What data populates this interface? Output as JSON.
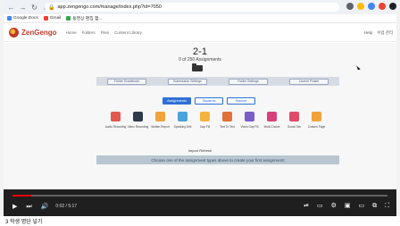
{
  "browser": {
    "url": "app.zengengo.com/manage/index.php?id=7050",
    "bookmarks": [
      {
        "label": "Google Docs",
        "color": "#4285f4"
      },
      {
        "label": "Gmail",
        "color": "#ea4335"
      },
      {
        "label": "동영상 편집 앱...",
        "color": "#34a853"
      }
    ]
  },
  "app": {
    "logo": "ZenGengo",
    "nav": [
      "Home",
      "Folders",
      "Files",
      "Content Library"
    ],
    "right": [
      "Help",
      "수업 관리"
    ]
  },
  "page": {
    "title": "2-1",
    "subtitle": "0 of 250 Assignments",
    "panel_buttons": [
      "Folder Gradebook",
      "Submission Settings",
      "Folder Settings",
      "Launch Poster"
    ],
    "tabs": [
      {
        "label": "Assignments",
        "active": true
      },
      {
        "label": "Students",
        "active": false
      },
      {
        "label": "Teacher",
        "active": false
      }
    ],
    "tiles": [
      {
        "label": "Audio Recording",
        "color": "#e05a4f"
      },
      {
        "label": "Video Recording",
        "color": "#2f3b4a"
      },
      {
        "label": "Written Report",
        "color": "#f0a33a"
      },
      {
        "label": "Speaking Drill",
        "color": "#4aa3d9"
      },
      {
        "label": "Gap Fill",
        "color": "#f3b33d"
      },
      {
        "label": "Text To Text",
        "color": "#e0703a"
      },
      {
        "label": "Video Gap Fill",
        "color": "#7a5ec8"
      },
      {
        "label": "Multi-Choice",
        "color": "#d7407a"
      },
      {
        "label": "Social Tab",
        "color": "#e04a6a"
      },
      {
        "label": "Custom Page",
        "color": "#f0a33a"
      }
    ],
    "import_row": "Import  Refresh",
    "banner": "Choose one of the assignment types above to create your first assignment!"
  },
  "player": {
    "time": "0:02 / 5:17",
    "progress": 0.05
  },
  "caption": "3 학생 명단 넣기"
}
